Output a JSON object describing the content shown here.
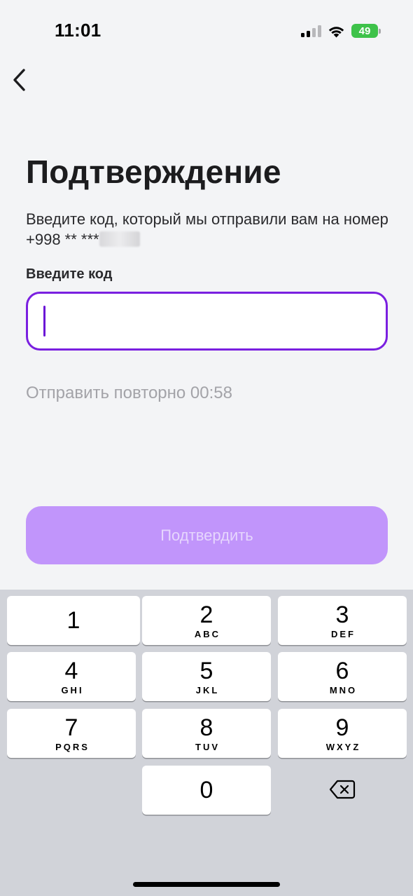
{
  "status_bar": {
    "time": "11:01",
    "battery": "49"
  },
  "header": {
    "back_icon": "chevron-left-icon"
  },
  "main": {
    "title": "Подтверждение",
    "subtitle": "Введите код, который мы отправили вам на номер +998 ** ***",
    "code_label": "Введите код",
    "code_value": "",
    "resend_text": "Отправить повторно 00:58",
    "confirm_label": "Подтвердить"
  },
  "colors": {
    "accent": "#7a1fe0",
    "button_disabled": "#c195fb",
    "muted_text": "#a3a3a8"
  },
  "keypad": {
    "keys": [
      {
        "digit": "1",
        "letters": ""
      },
      {
        "digit": "2",
        "letters": "ABC"
      },
      {
        "digit": "3",
        "letters": "DEF"
      },
      {
        "digit": "4",
        "letters": "GHI"
      },
      {
        "digit": "5",
        "letters": "JKL"
      },
      {
        "digit": "6",
        "letters": "MNO"
      },
      {
        "digit": "7",
        "letters": "PQRS"
      },
      {
        "digit": "8",
        "letters": "TUV"
      },
      {
        "digit": "9",
        "letters": "WXYZ"
      },
      {
        "digit": "0",
        "letters": ""
      }
    ],
    "delete_icon": "backspace-icon"
  }
}
